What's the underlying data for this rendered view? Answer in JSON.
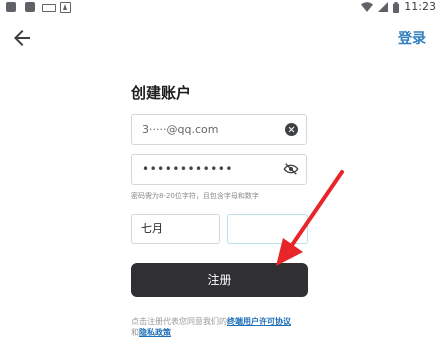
{
  "status_bar": {
    "time": "11:23"
  },
  "header": {
    "login_label": "登录"
  },
  "form": {
    "title": "创建账户",
    "email_value": "3·····@qq.com",
    "password_value": "••••••••••••",
    "password_hint": "密码需为8-20位字符，且包含字母和数字",
    "birth_month": "七月",
    "birth_day": "",
    "register_label": "注册"
  },
  "terms": {
    "prefix": "点击注册代表您同意我们的",
    "agreement_link": "终端用户许可协议",
    "conjunction": "和",
    "privacy_link": "隐私政策"
  },
  "colors": {
    "accent": "#2f7fbf",
    "button": "#303033",
    "annotation_arrow": "#e8262a"
  }
}
